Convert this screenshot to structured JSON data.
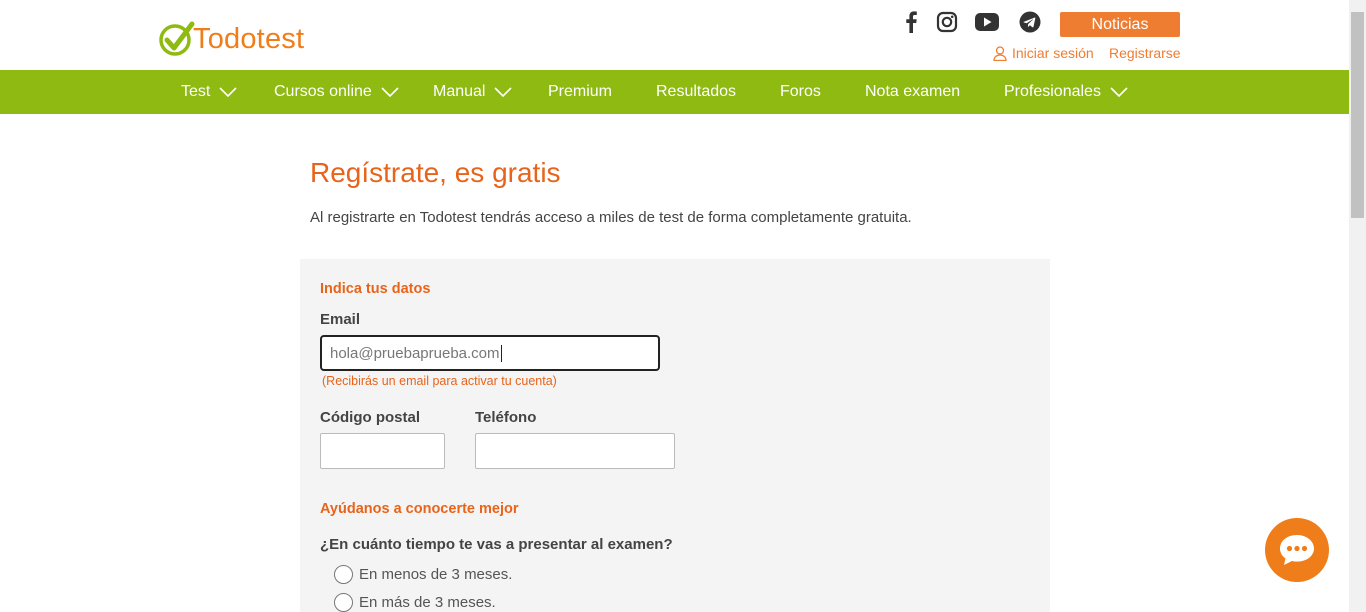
{
  "header": {
    "logo_text": "Todotest",
    "social": [
      "facebook-icon",
      "instagram-icon",
      "youtube-icon",
      "telegram-icon"
    ],
    "news_button": "Noticias",
    "login": "Iniciar sesión",
    "register": "Registrarse"
  },
  "nav": {
    "items": [
      {
        "label": "Test",
        "dropdown": true
      },
      {
        "label": "Cursos online",
        "dropdown": true
      },
      {
        "label": "Manual",
        "dropdown": true
      },
      {
        "label": "Premium",
        "dropdown": false
      },
      {
        "label": "Resultados",
        "dropdown": false
      },
      {
        "label": "Foros",
        "dropdown": false
      },
      {
        "label": "Nota examen",
        "dropdown": false
      },
      {
        "label": "Profesionales",
        "dropdown": true
      }
    ]
  },
  "page": {
    "title": "Regístrate, es gratis",
    "intro": "Al registrarte en Todotest tendrás acceso a miles de test de forma completamente gratuita."
  },
  "form": {
    "section1": "Indica tus datos",
    "email_label": "Email",
    "email_value": "hola@pruebaprueba.com",
    "email_hint": "(Recibirás un email para activar tu cuenta)",
    "postal_label": "Código postal",
    "postal_value": "",
    "phone_label": "Teléfono",
    "phone_value": "",
    "section2": "Ayúdanos a conocerte mejor",
    "question": "¿En cuánto tiempo te vas a presentar al examen?",
    "options": [
      "En menos de 3 meses.",
      "En más de 3 meses."
    ]
  },
  "colors": {
    "brand_orange": "#ef7d31",
    "nav_green": "#8fba12"
  }
}
